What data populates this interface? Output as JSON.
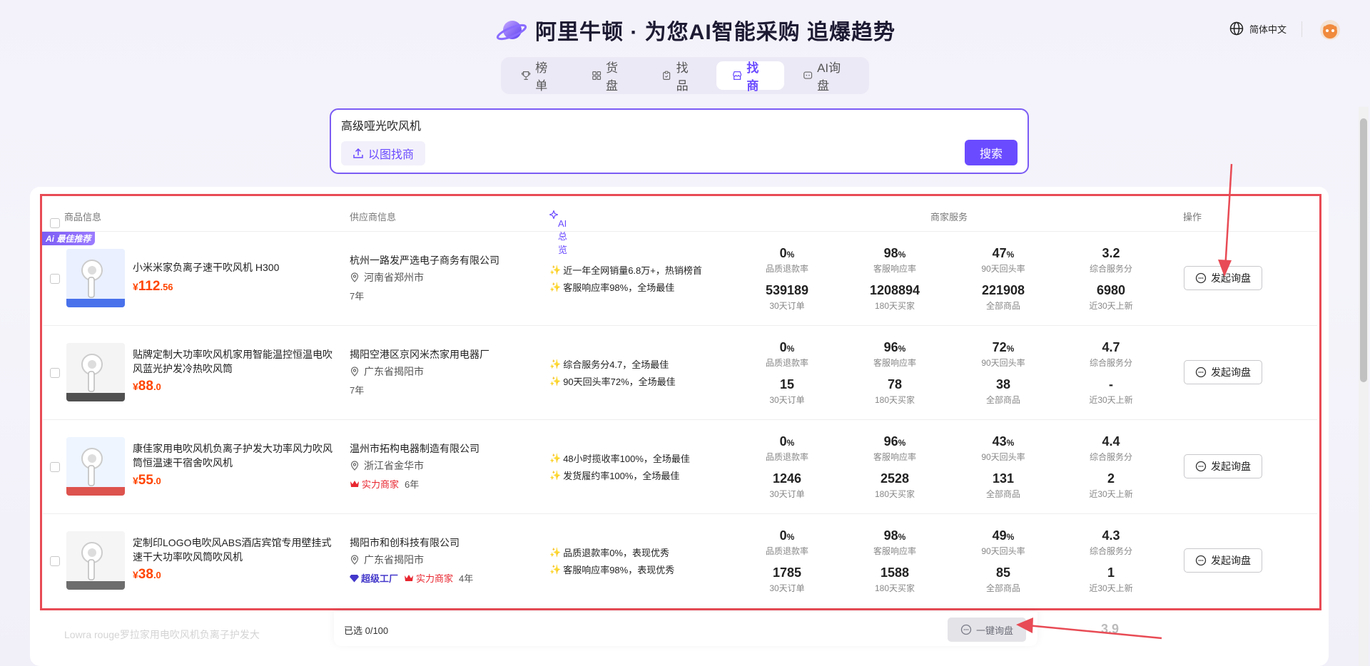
{
  "brand": {
    "title": "阿里牛顿 · 为您AI智能采购 追爆趋势"
  },
  "lang": {
    "label": "简体中文"
  },
  "tabs": [
    {
      "label": "榜单",
      "icon": "trophy-icon"
    },
    {
      "label": "货盘",
      "icon": "grid-icon"
    },
    {
      "label": "找品",
      "icon": "clipboard-icon"
    },
    {
      "label": "找商",
      "icon": "store-icon"
    },
    {
      "label": "AI询盘",
      "icon": "chat-icon"
    }
  ],
  "search": {
    "value": "高级哑光吹风机",
    "image_search_label": "以图找商",
    "button_label": "搜索"
  },
  "table": {
    "headers": {
      "product": "商品信息",
      "supplier": "供应商信息",
      "ai": "AI总览",
      "service": "商家服务",
      "action": "操作"
    },
    "best_tag": "Ai 最佳推荐",
    "metric_labels": [
      "品质退款率",
      "客服响应率",
      "90天回头率",
      "综合服务分",
      "30天订单",
      "180天买家",
      "全部商品",
      "近30天上新"
    ],
    "inquire_label": "发起询盘",
    "rows": [
      {
        "name": "小米米家负离子速干吹风机 H300",
        "price_int": "112",
        "price_dec": ".56",
        "currency": "¥",
        "supplier": "杭州一路发严选电子商务有限公司",
        "region": "河南省郑州市",
        "years": "7年",
        "badges": [],
        "ai": [
          "近一年全网销量6.8万+，热销榜首",
          "客服响应率98%，全场最佳"
        ],
        "m1": "0",
        "m2": "98",
        "m3": "47",
        "m4": "3.2",
        "m5": "539189",
        "m6": "1208894",
        "m7": "221908",
        "m8": "6980"
      },
      {
        "name": "贴牌定制大功率吹风机家用智能温控恒温电吹风蓝光护发冷热吹风筒",
        "price_int": "88",
        "price_dec": ".0",
        "currency": "¥",
        "supplier": "揭阳空港区京冈米杰家用电器厂",
        "region": "广东省揭阳市",
        "years": "7年",
        "badges": [],
        "ai": [
          "综合服务分4.7，全场最佳",
          "90天回头率72%，全场最佳"
        ],
        "m1": "0",
        "m2": "96",
        "m3": "72",
        "m4": "4.7",
        "m5": "15",
        "m6": "78",
        "m7": "38",
        "m8": "-"
      },
      {
        "name": "康佳家用电吹风机负离子护发大功率风力吹风筒恒温速干宿舍吹风机",
        "price_int": "55",
        "price_dec": ".0",
        "currency": "¥",
        "supplier": "温州市拓构电器制造有限公司",
        "region": "浙江省金华市",
        "years": "6年",
        "badges": [
          "实力商家"
        ],
        "ai": [
          "48小时揽收率100%，全场最佳",
          "发货履约率100%，全场最佳"
        ],
        "m1": "0",
        "m2": "96",
        "m3": "43",
        "m4": "4.4",
        "m5": "1246",
        "m6": "2528",
        "m7": "131",
        "m8": "2"
      },
      {
        "name": "定制印LOGO电吹风ABS酒店宾馆专用壁挂式速干大功率吹风筒吹风机",
        "price_int": "38",
        "price_dec": ".0",
        "currency": "¥",
        "supplier": "揭阳市和创科技有限公司",
        "region": "广东省揭阳市",
        "years": "4年",
        "badges": [
          "超级工厂",
          "实力商家"
        ],
        "ai": [
          "品质退款率0%，表现优秀",
          "客服响应率98%，表现优秀"
        ],
        "m1": "0",
        "m2": "98",
        "m3": "49",
        "m4": "4.3",
        "m5": "1785",
        "m6": "1588",
        "m7": "85",
        "m8": "1"
      }
    ]
  },
  "ghost": {
    "name": "Lowra rouge罗拉家用电吹风机负离子护发大",
    "metric": "3.9"
  },
  "bottom": {
    "selected": "已选 0/100",
    "bulk_label": "一键询盘"
  },
  "colors": {
    "accent": "#6b4bff",
    "price": "#ff4400",
    "highlight": "#e84b55"
  }
}
